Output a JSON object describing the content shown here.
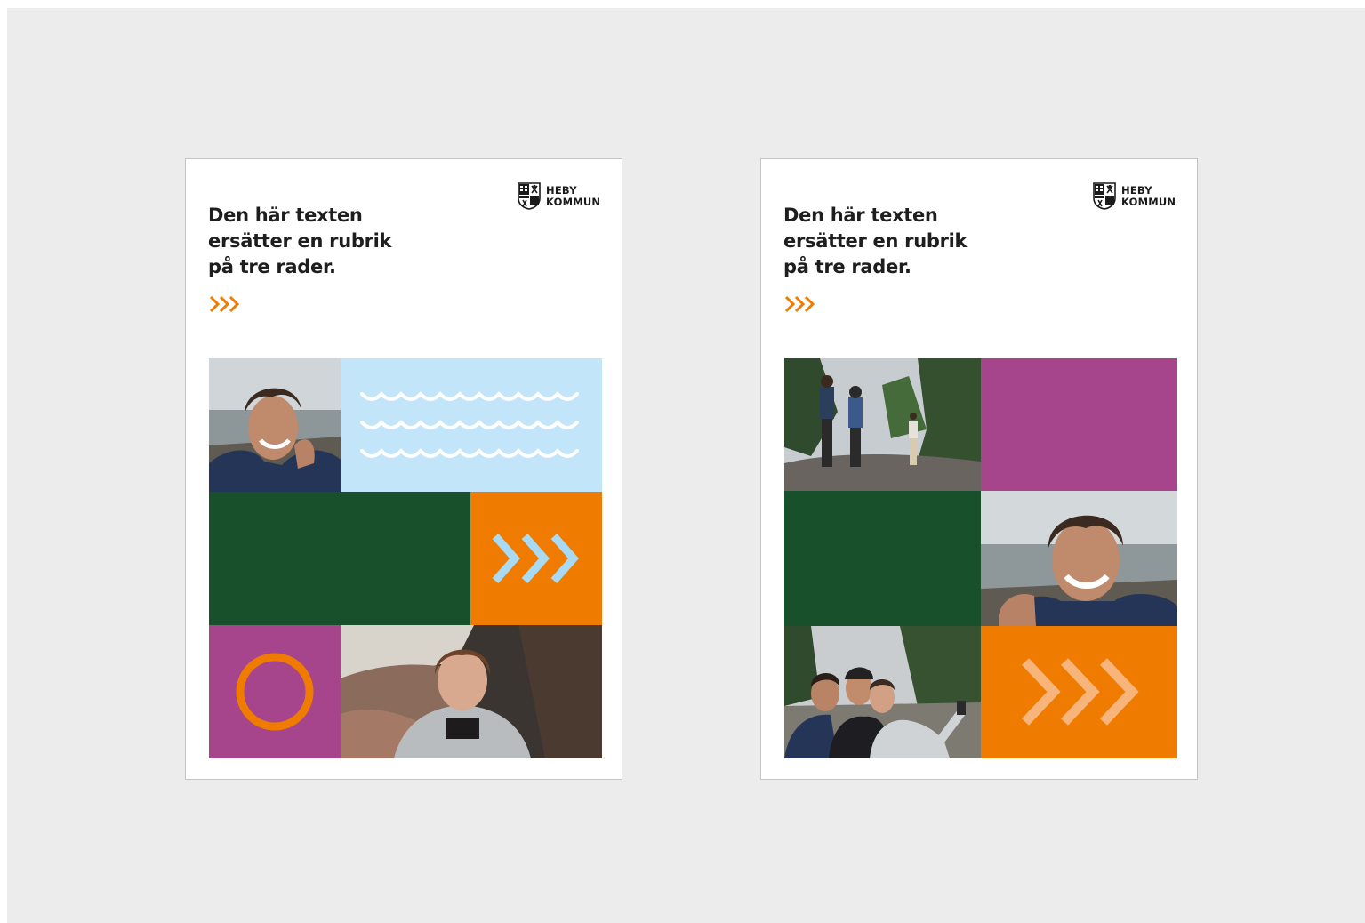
{
  "colors": {
    "background": "#ececec",
    "card": "#ffffff",
    "green": "#17502a",
    "orange": "#ef7c00",
    "purple": "#a6458c",
    "light_blue": "#c3e5f9",
    "headline_text": "#1e1e1e"
  },
  "cards": [
    {
      "logo": {
        "line1": "HEBY",
        "line2": "KOMMUN",
        "icon": "coat-of-arms-shield-icon"
      },
      "headline": {
        "line1": "Den här texten",
        "line2": "ersätter en rubrik",
        "line3": "på tre rader."
      },
      "accent_icon": "triple-chevron-icon",
      "tiles": [
        {
          "type": "photo",
          "subject": "smiling young man in navy jacket by the sea"
        },
        {
          "type": "pattern",
          "pattern": "waves",
          "color": "light_blue"
        },
        {
          "type": "color-block",
          "color": "green"
        },
        {
          "type": "pattern",
          "pattern": "chevrons",
          "color": "orange"
        },
        {
          "type": "pattern",
          "pattern": "ring",
          "color": "purple"
        },
        {
          "type": "photo",
          "subject": "smiling young woman in grey hoodie on rocky shore"
        }
      ]
    },
    {
      "logo": {
        "line1": "HEBY",
        "line2": "KOMMUN",
        "icon": "coat-of-arms-shield-icon"
      },
      "headline": {
        "line1": "Den här texten",
        "line2": "ersätter en rubrik",
        "line3": "på tre rader."
      },
      "accent_icon": "triple-chevron-icon",
      "tiles": [
        {
          "type": "photo",
          "subject": "hikers with backpacks walking among pine trees"
        },
        {
          "type": "color-block",
          "color": "purple"
        },
        {
          "type": "color-block",
          "color": "green"
        },
        {
          "type": "photo",
          "subject": "smiling young man in navy jacket by the sea"
        },
        {
          "type": "photo",
          "subject": "group of friends taking a selfie in the forest"
        },
        {
          "type": "pattern",
          "pattern": "chevrons",
          "color": "orange"
        }
      ]
    }
  ]
}
